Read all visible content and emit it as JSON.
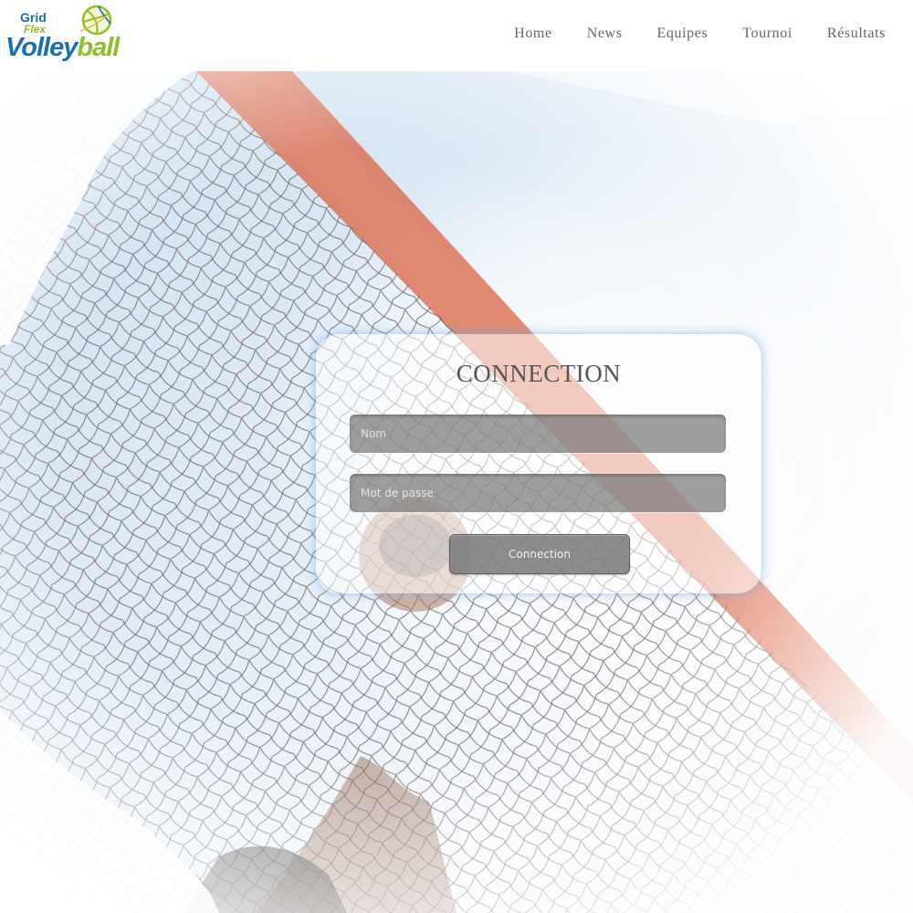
{
  "header": {
    "logo": {
      "line1": "Grid",
      "line2": "Flex",
      "word_main": "Volley",
      "word_accent": "ball"
    },
    "nav": [
      {
        "label": "Home"
      },
      {
        "label": "News"
      },
      {
        "label": "Equipes"
      },
      {
        "label": "Tournoi"
      },
      {
        "label": "Résultats"
      }
    ]
  },
  "login": {
    "title": "CONNECTION",
    "name_placeholder": "Nom",
    "password_placeholder": "Mot de passe",
    "submit_label": "Connection"
  },
  "colors": {
    "brand_blue": "#1b6fb0",
    "brand_green": "#8fbf2c",
    "nav_text": "#666666",
    "net_band": "#d9603f",
    "card_glow": "#78afe6"
  },
  "icons": {
    "logo_ball": "volleyball-icon"
  }
}
